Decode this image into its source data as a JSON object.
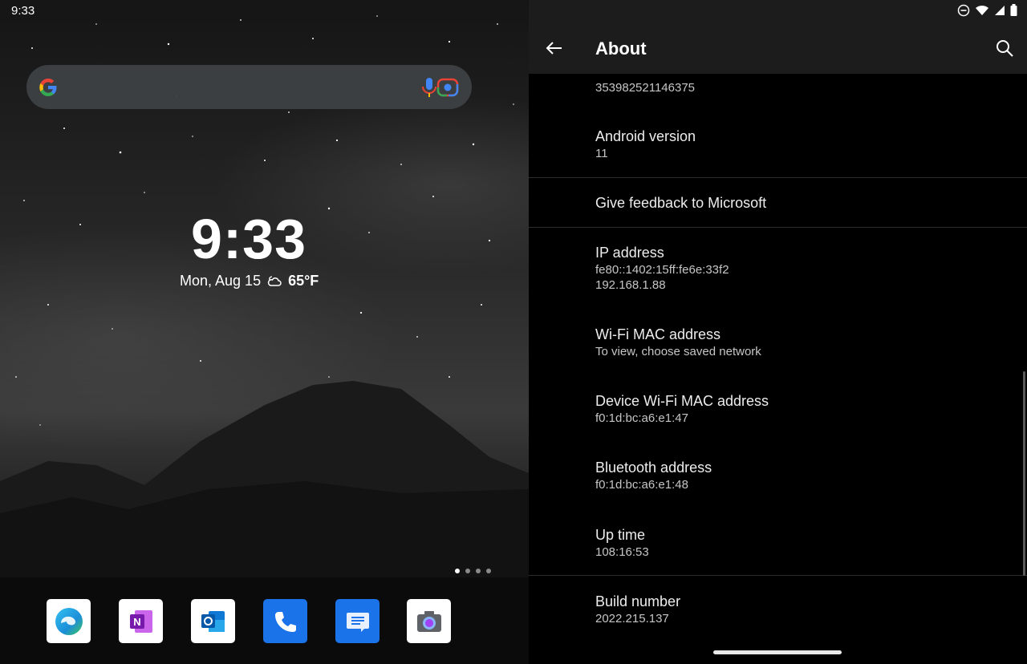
{
  "home": {
    "status_time": "9:33",
    "clock": "9:33",
    "date": "Mon, Aug 15",
    "temperature": "65°F",
    "weather_icon": "partly-cloudy-night-icon",
    "page_count": 4,
    "active_page": 1,
    "dock_apps": [
      {
        "name": "Edge",
        "icon": "edge-icon"
      },
      {
        "name": "OneNote",
        "icon": "onenote-icon"
      },
      {
        "name": "Outlook",
        "icon": "outlook-icon"
      },
      {
        "name": "Phone",
        "icon": "phone-icon"
      },
      {
        "name": "Messages",
        "icon": "messages-icon"
      },
      {
        "name": "Camera",
        "icon": "camera-icon"
      }
    ]
  },
  "settings": {
    "title": "About",
    "items": [
      {
        "label": "",
        "value": "353982521146375"
      },
      {
        "label": "Android version",
        "value": "11"
      },
      {
        "label": "Give feedback to Microsoft",
        "value": ""
      },
      {
        "label": "IP address",
        "value": "fe80::1402:15ff:fe6e:33f2",
        "value2": "192.168.1.88"
      },
      {
        "label": "Wi-Fi MAC address",
        "value": "To view, choose saved network"
      },
      {
        "label": "Device Wi-Fi MAC address",
        "value": "f0:1d:bc:a6:e1:47"
      },
      {
        "label": "Bluetooth address",
        "value": "f0:1d:bc:a6:e1:48"
      },
      {
        "label": "Up time",
        "value": "108:16:53"
      },
      {
        "label": "Build number",
        "value": "2022.215.137"
      }
    ]
  },
  "colors": {
    "topbar": "#1c1c1c",
    "background": "#000000",
    "phone_app": "#1a73e8",
    "messages_app": "#1a73e8"
  }
}
